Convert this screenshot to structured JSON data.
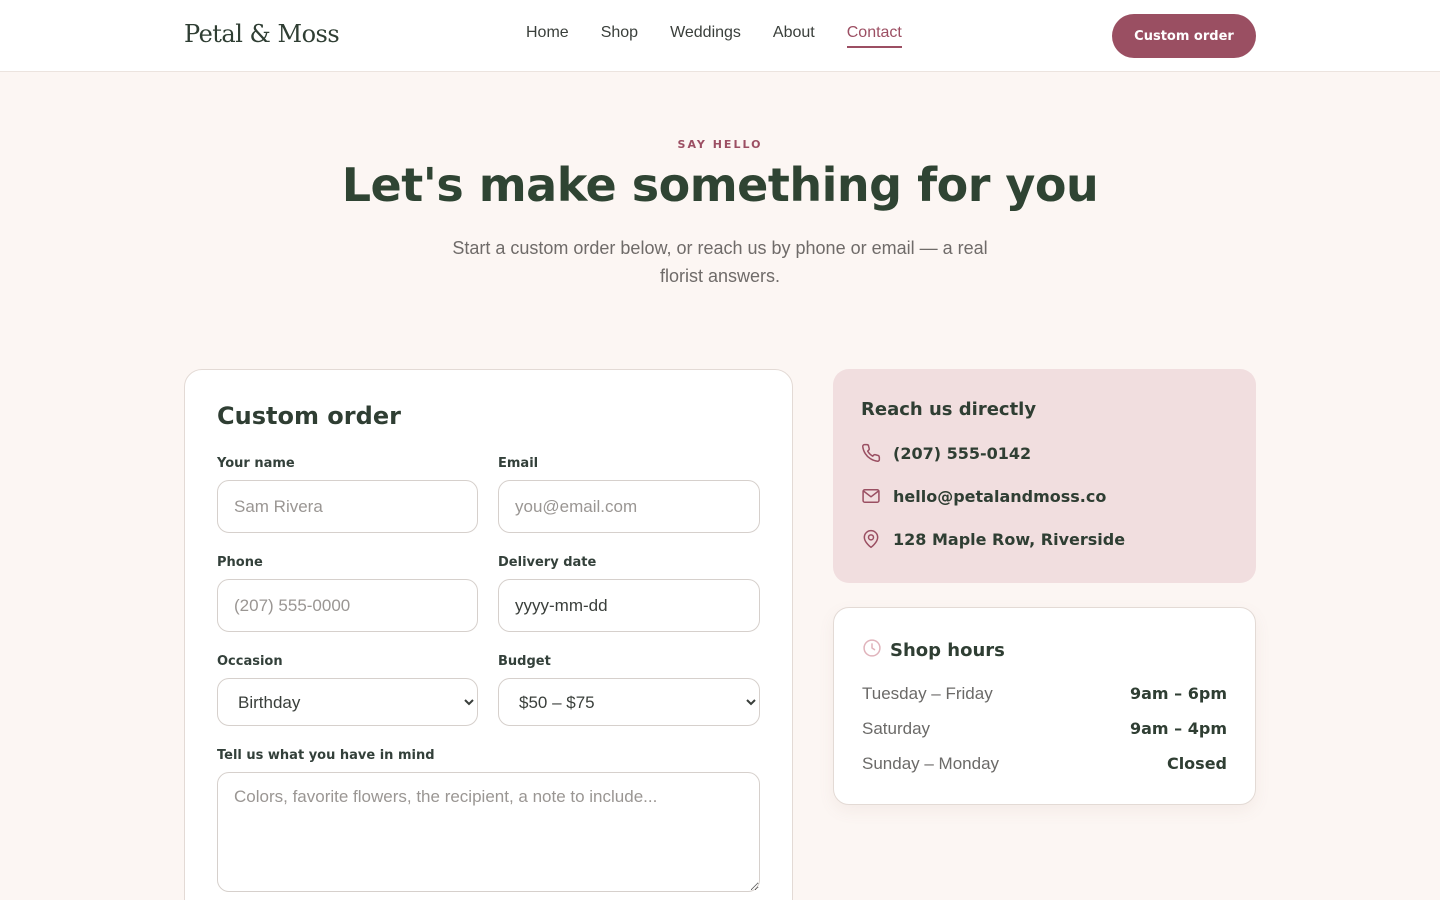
{
  "brand": {
    "logo": "Petal & Moss"
  },
  "nav": {
    "items": [
      {
        "label": "Home"
      },
      {
        "label": "Shop"
      },
      {
        "label": "Weddings"
      },
      {
        "label": "About"
      },
      {
        "label": "Contact"
      }
    ],
    "active": "Contact",
    "cta_label": "Custom order"
  },
  "hero": {
    "eyebrow": "SAY HELLO",
    "title": "Let's make something for you",
    "subtitle": "Start a custom order below, or reach us by phone or email — a real florist answers."
  },
  "form": {
    "title": "Custom order",
    "name": {
      "label": "Your name",
      "placeholder": "Sam Rivera"
    },
    "email": {
      "label": "Email",
      "placeholder": "you@email.com"
    },
    "phone": {
      "label": "Phone",
      "placeholder": "(207) 555-0000"
    },
    "date": {
      "label": "Delivery date",
      "placeholder": "yyyy-mm-dd"
    },
    "occasion": {
      "label": "Occasion",
      "value": "Birthday"
    },
    "budget": {
      "label": "Budget",
      "value": "$50 – $75"
    },
    "message": {
      "label": "Tell us what you have in mind",
      "placeholder": "Colors, favorite flowers, the recipient, a note to include..."
    }
  },
  "reach": {
    "title": "Reach us directly",
    "phone": "(207) 555-0142",
    "email": "hello@petalandmoss.co",
    "address": "128 Maple Row, Riverside"
  },
  "hours": {
    "title": "Shop hours",
    "rows": [
      {
        "day": "Tuesday – Friday",
        "time": "9am – 6pm"
      },
      {
        "day": "Saturday",
        "time": "9am – 4pm"
      },
      {
        "day": "Sunday – Monday",
        "time": "Closed"
      }
    ]
  },
  "colors": {
    "accent": "#9a4f62",
    "heading": "#2f4433",
    "reach_bg": "#f1dedf",
    "page_bg": "#fcf6f3"
  }
}
